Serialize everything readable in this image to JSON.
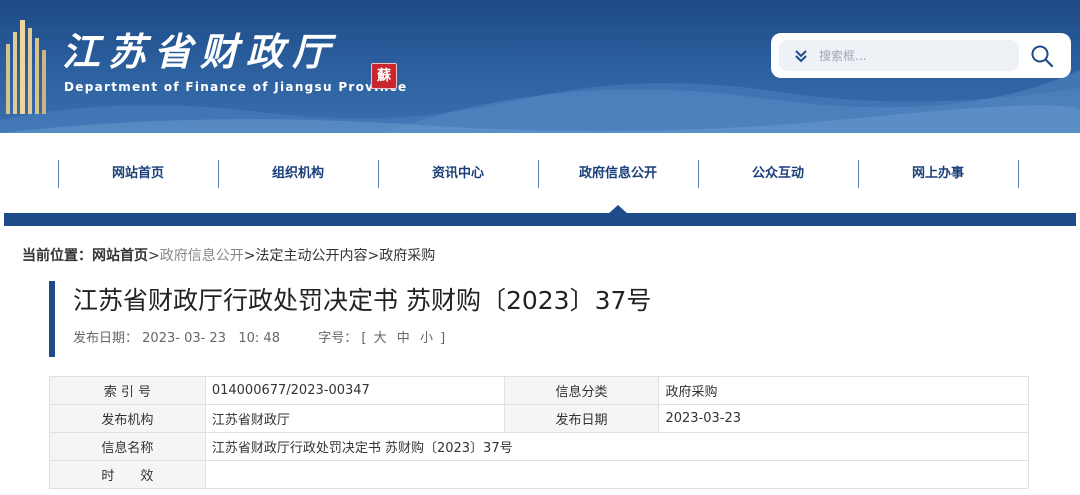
{
  "header": {
    "title": "江苏省财政厅",
    "subtitle": "Department of Finance of Jiangsu Province",
    "seal_char": "蘇",
    "search": {
      "placeholder": "搜索框...",
      "dropdown_icon": "chevron-double-down-icon",
      "button_icon": "search-icon"
    },
    "colors": {
      "banner": "#2a5d9c",
      "nav_text": "#1a3f7a",
      "accent_bar": "#1f4b89",
      "seal": "#c8282d"
    }
  },
  "nav": {
    "items": [
      {
        "label": "网站首页"
      },
      {
        "label": "组织机构"
      },
      {
        "label": "资讯中心"
      },
      {
        "label": "政府信息公开",
        "active": true
      },
      {
        "label": "公众互动"
      },
      {
        "label": "网上办事"
      }
    ]
  },
  "breadcrumb": {
    "prefix": "当前位置：",
    "items": [
      "网站首页",
      "政府信息公开",
      "法定主动公开内容",
      "政府采购"
    ],
    "separator": ">"
  },
  "article": {
    "title": "江苏省财政厅行政处罚决定书 苏财购〔2023〕37号",
    "publish_label": "发布日期：",
    "publish_value": "2023- 03- 23   10: 48",
    "font_label": "字号：",
    "font_open": "[",
    "font_large": "大",
    "font_medium": "中",
    "font_small": "小",
    "font_close": "]"
  },
  "info_table": {
    "rows": [
      {
        "k1": "索 引 号",
        "v1": "014000677/2023-00347",
        "k2": "信息分类",
        "v2": "政府采购"
      },
      {
        "k1": "发布机构",
        "v1": "江苏省财政厅",
        "k2": "发布日期",
        "v2": "2023-03-23"
      },
      {
        "k1": "信息名称",
        "v1": "江苏省财政厅行政处罚决定书 苏财购〔2023〕37号"
      },
      {
        "k1": "时　　效",
        "v1": ""
      }
    ]
  }
}
